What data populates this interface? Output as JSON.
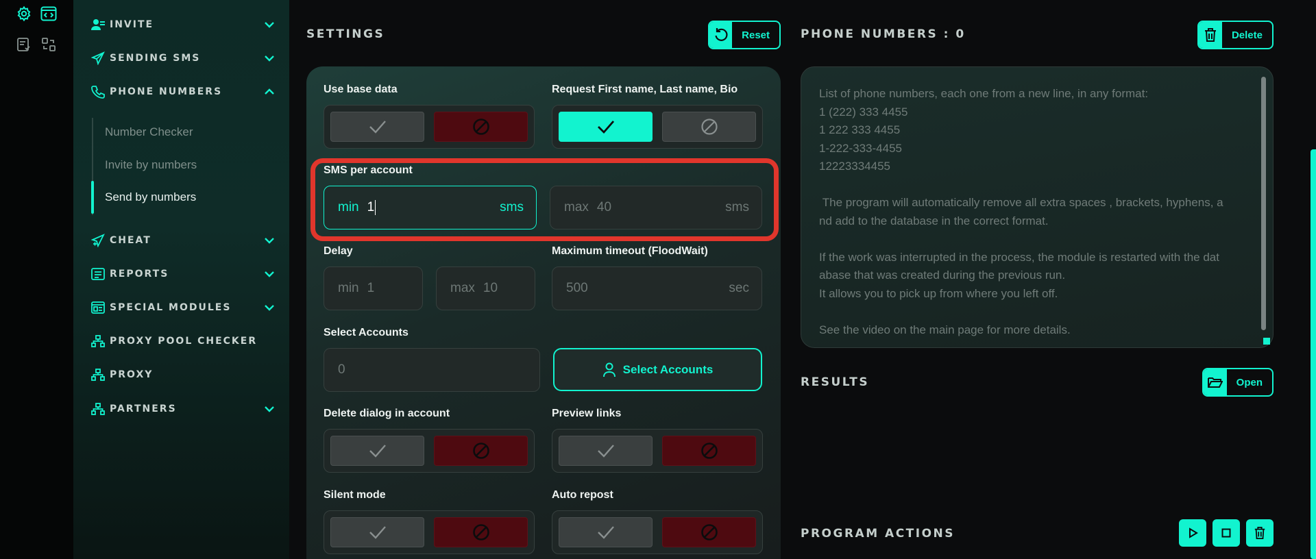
{
  "rail": {
    "icons": [
      "settings-icon",
      "code-window-icon",
      "checklist-icon",
      "swap-icon"
    ]
  },
  "sidebar": {
    "items": [
      {
        "label": "INVITE",
        "icon": "user-add-icon",
        "chevron": "down"
      },
      {
        "label": "SENDING SMS",
        "icon": "send-icon",
        "chevron": "down"
      },
      {
        "label": "PHONE NUMBERS",
        "icon": "phone-icon",
        "chevron": "up"
      },
      {
        "label": "CHEAT",
        "icon": "send-plus-icon",
        "chevron": "down"
      },
      {
        "label": "REPORTS",
        "icon": "report-icon",
        "chevron": "down"
      },
      {
        "label": "SPECIAL MODULES",
        "icon": "modules-icon",
        "chevron": "down"
      },
      {
        "label": "PROXY POOL CHECKER",
        "icon": "network-icon",
        "chevron": ""
      },
      {
        "label": "PROXY",
        "icon": "network-icon",
        "chevron": ""
      },
      {
        "label": "PARTNERS",
        "icon": "network-icon",
        "chevron": "down"
      }
    ],
    "sub_items": [
      {
        "label": "Number Checker",
        "active": false
      },
      {
        "label": "Invite by numbers",
        "active": false
      },
      {
        "label": "Send by numbers",
        "active": true
      }
    ]
  },
  "settings": {
    "title": "SETTINGS",
    "reset_label": "Reset",
    "use_base_data": {
      "label": "Use base data",
      "state": "no"
    },
    "request_names": {
      "label": "Request First name, Last name, Bio",
      "state": "yes"
    },
    "sms_per_account": {
      "label": "SMS per account",
      "min_prefix": "min",
      "min_value": "1",
      "min_suffix": "sms",
      "max_prefix": "max",
      "max_placeholder": "40",
      "max_suffix": "sms"
    },
    "delay": {
      "label": "Delay",
      "min_prefix": "min",
      "min_placeholder": "1",
      "max_prefix": "max",
      "max_placeholder": "10"
    },
    "max_timeout": {
      "label": "Maximum timeout (FloodWait)",
      "placeholder": "500",
      "suffix": "sec"
    },
    "select_accounts": {
      "label": "Select Accounts",
      "count_placeholder": "0",
      "button_label": "Select Accounts"
    },
    "delete_dialog": {
      "label": "Delete dialog in account",
      "state": "no"
    },
    "preview_links": {
      "label": "Preview links",
      "state": "no"
    },
    "silent_mode": {
      "label": "Silent mode",
      "state": "no"
    },
    "auto_repost": {
      "label": "Auto repost",
      "state": "no"
    }
  },
  "phone_numbers": {
    "title": "PHONE NUMBERS : 0",
    "delete_label": "Delete",
    "placeholder": "List of phone numbers, each one from a new line, in any format:\n1 (222) 333 4455\n1 222 333 4455\n1-222-333-4455\n12223334455\n\n The program will automatically remove all extra spaces , brackets, hyphens, a\nnd add to the database in the correct format.\n\nIf the work was interrupted in the process, the module is restarted with the dat\nabase that was created during the previous run.\nIt allows you to pick up from where you left off.\n\nSee the video on the main page for more details."
  },
  "results": {
    "title": "RESULTS",
    "open_label": "Open"
  },
  "program_actions": {
    "title": "PROGRAM ACTIONS",
    "buttons": [
      "play-icon",
      "stop-icon",
      "trash-icon"
    ]
  },
  "colors": {
    "accent": "#12f3cf",
    "danger": "#4e0a10",
    "highlight": "#e0362c"
  }
}
